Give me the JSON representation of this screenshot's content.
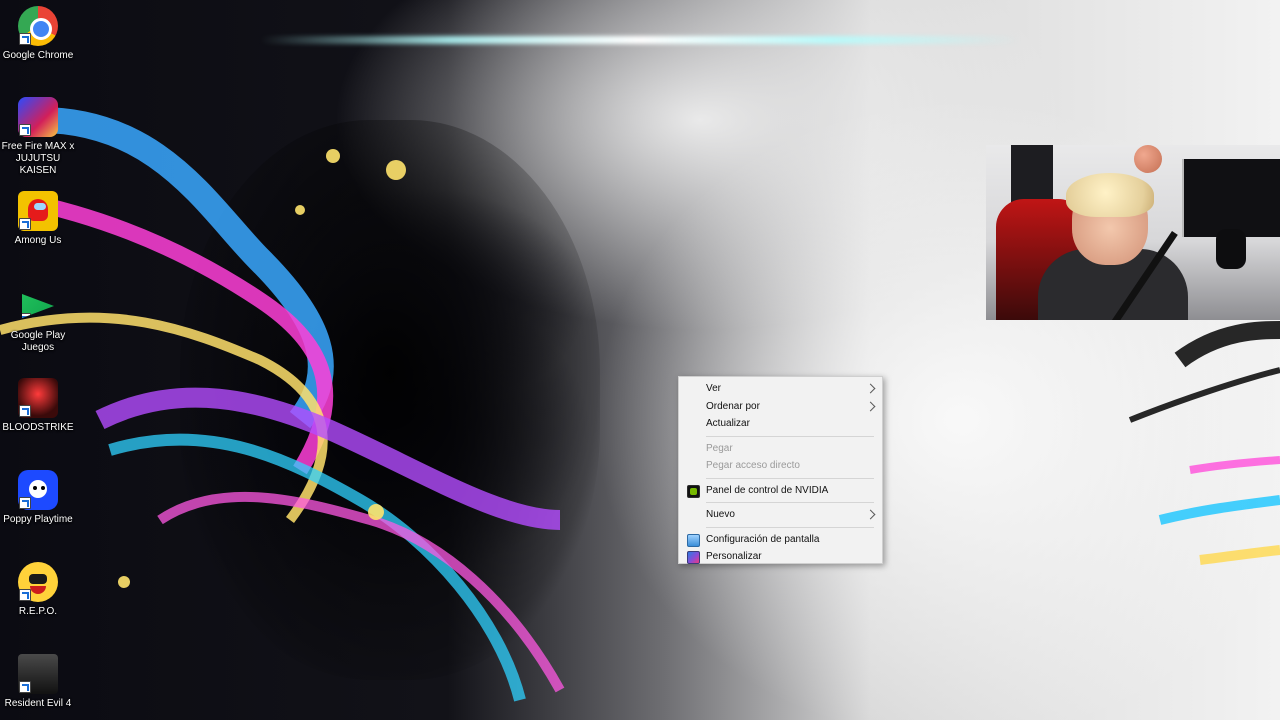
{
  "desktop": {
    "icons": [
      {
        "label": "Google Chrome",
        "icon": "chrome-icon"
      },
      {
        "label": "Free Fire MAX x JUJUTSU KAISEN",
        "icon": "free-fire-max-icon"
      },
      {
        "label": "Among Us",
        "icon": "among-us-icon"
      },
      {
        "label": "Google Play Juegos",
        "icon": "google-play-games-icon"
      },
      {
        "label": "BLOODSTRIKE",
        "icon": "bloodstrike-icon"
      },
      {
        "label": "Poppy Playtime",
        "icon": "poppy-playtime-icon"
      },
      {
        "label": "R.E.P.O.",
        "icon": "repo-icon"
      },
      {
        "label": "Resident Evil 4",
        "icon": "resident-evil-4-icon"
      }
    ]
  },
  "context_menu": {
    "items": [
      {
        "label": "Ver",
        "has_submenu": true,
        "enabled": true
      },
      {
        "label": "Ordenar por",
        "has_submenu": true,
        "enabled": true
      },
      {
        "label": "Actualizar",
        "has_submenu": false,
        "enabled": true
      },
      {
        "label": "Pegar",
        "has_submenu": false,
        "enabled": false
      },
      {
        "label": "Pegar acceso directo",
        "has_submenu": false,
        "enabled": false
      },
      {
        "label": "Panel de control de NVIDIA",
        "has_submenu": false,
        "enabled": true,
        "icon": "nvidia-icon"
      },
      {
        "label": "Nuevo",
        "has_submenu": true,
        "enabled": true
      },
      {
        "label": "Configuración de pantalla",
        "has_submenu": false,
        "enabled": true,
        "icon": "display-settings-icon"
      },
      {
        "label": "Personalizar",
        "has_submenu": false,
        "enabled": true,
        "icon": "personalize-icon"
      }
    ]
  },
  "colors": {
    "menu_bg": "#f2f2f2",
    "menu_text": "#111111",
    "menu_disabled_text": "#9a9a9a",
    "nvidia_green": "#76b900"
  }
}
